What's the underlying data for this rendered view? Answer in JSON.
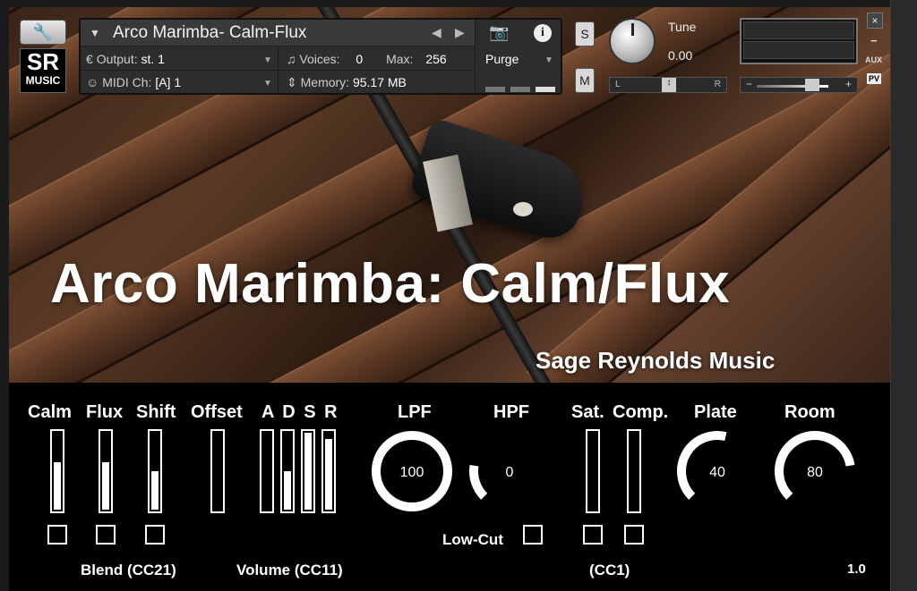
{
  "kontakt": {
    "instrument_name": "Arco Marimba- Calm-Flux",
    "output_label": "Output:",
    "output_value": "st. 1",
    "voices_label": "Voices:",
    "voices_value": "0",
    "max_label": "Max:",
    "max_value": "256",
    "purge_label": "Purge",
    "midi_label": "MIDI Ch:",
    "midi_value": "[A]  1",
    "memory_label": "Memory:",
    "memory_value": "95.17 MB",
    "solo_label": "S",
    "mute_label": "M",
    "tune_label": "Tune",
    "tune_value": "0.00",
    "pan_left": "L",
    "pan_right": "R",
    "vol_minus": "−",
    "vol_plus": "+",
    "close_label": "×",
    "min_label": "−",
    "aux_label": "AUX",
    "pv_label": "PV",
    "wrench_icon": "wrench-icon",
    "logo_sr": "SR",
    "logo_music": "MUSIC"
  },
  "artwork": {
    "title": "Arco Marimba: Calm/Flux",
    "subtitle": "Sage Reynolds Music"
  },
  "controls": {
    "calm": {
      "label": "Calm",
      "value": 0.62,
      "checked": false
    },
    "flux": {
      "label": "Flux",
      "value": 0.62,
      "checked": false
    },
    "shift": {
      "label": "Shift",
      "value": 0.5,
      "checked": false
    },
    "offset": {
      "label": "Offset",
      "value": 0.0
    },
    "adsr_label": "A D S R",
    "adsr": {
      "A": 0.0,
      "D": 0.5,
      "S": 1.0,
      "R": 0.92
    },
    "lpf": {
      "label": "LPF",
      "value": "100",
      "fraction": 1.0
    },
    "hpf": {
      "label": "HPF",
      "value": "0",
      "fraction": 0.2
    },
    "sat": {
      "label": "Sat.",
      "value": 0.0,
      "checked": false
    },
    "comp": {
      "label": "Comp.",
      "value": 0.0,
      "checked": false
    },
    "plate": {
      "label": "Plate",
      "value": "40",
      "fraction": 0.55
    },
    "room": {
      "label": "Room",
      "value": "80",
      "fraction": 0.8
    },
    "lowcut_label": "Low-Cut",
    "lowcut_checked": false,
    "blend_label": "Blend (CC21)",
    "volume_label": "Volume (CC11)",
    "cc1_label": "(CC1)",
    "version": "1.0"
  }
}
